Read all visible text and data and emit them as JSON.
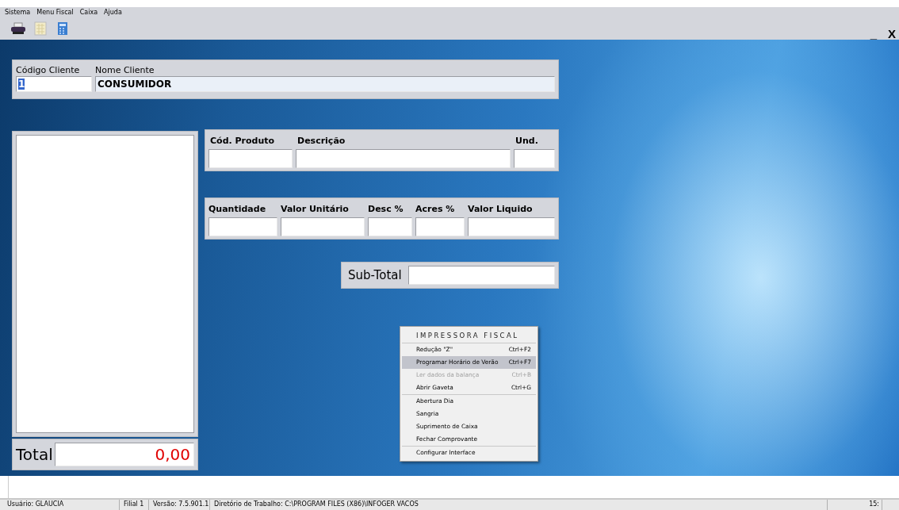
{
  "menu_bar": [
    "Sistema",
    "Menu Fiscal",
    "Caixa",
    "Ajuda"
  ],
  "window_controls": {
    "minimize": "_",
    "close": "X"
  },
  "client": {
    "code_label": "Código Cliente",
    "code_value": "1",
    "name_label": "Nome Cliente",
    "name_value": "CONSUMIDOR"
  },
  "product": {
    "columns": [
      {
        "label": "Cód. Produto"
      },
      {
        "label": "Descrição"
      },
      {
        "label": "Und."
      }
    ]
  },
  "pricing": {
    "columns": [
      {
        "label": "Quantidade"
      },
      {
        "label": "Valor Unitário"
      },
      {
        "label": "Desc %"
      },
      {
        "label": "Acres %"
      },
      {
        "label": "Valor Liquido"
      }
    ]
  },
  "subtotal": {
    "label": "Sub-Total"
  },
  "total": {
    "label": "Total",
    "value": "0,00"
  },
  "context_menu": {
    "title": "IMPRESSORA FISCAL",
    "groups": [
      [
        {
          "label": "Redução \"Z\"",
          "shortcut": "Ctrl+F2",
          "selected": false,
          "disabled": false
        },
        {
          "label": "Programar Horário de Verão",
          "shortcut": "Ctrl+F7",
          "selected": true,
          "disabled": false
        },
        {
          "label": "Ler dados da balança",
          "shortcut": "Ctrl+B",
          "selected": false,
          "disabled": true
        },
        {
          "label": "Abrir Gaveta",
          "shortcut": "Ctrl+G",
          "selected": false,
          "disabled": false
        }
      ],
      [
        {
          "label": "Abertura Dia",
          "selected": false,
          "disabled": false
        },
        {
          "label": "Sangria",
          "selected": false,
          "disabled": false
        },
        {
          "label": "Suprimento de Caixa",
          "selected": false,
          "disabled": false
        },
        {
          "label": "Fechar Comprovante",
          "selected": false,
          "disabled": false
        }
      ],
      [
        {
          "label": "Configurar Interface",
          "selected": false,
          "disabled": false
        }
      ]
    ]
  },
  "status_bar": [
    "Usuário: GLAUCIA",
    "Filial 1",
    "Versão:  7.5.901.1",
    "Diretório de Trabalho: C:\\PROGRAM FILES (X86)\\INFOGER VACOS",
    "15:"
  ]
}
